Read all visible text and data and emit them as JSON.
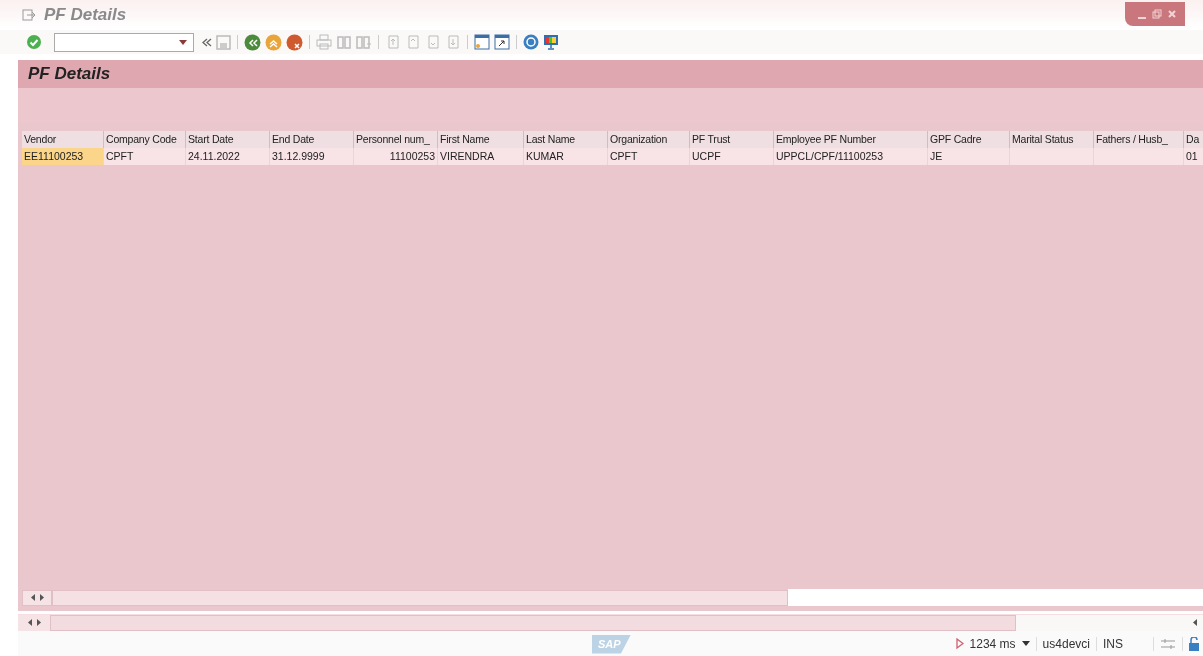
{
  "window": {
    "title": "PF Details"
  },
  "panel": {
    "title": "PF Details"
  },
  "table": {
    "columns": [
      "Vendor",
      "Company Code",
      "Start Date",
      "End Date",
      "Personnel num_",
      "First Name",
      "Last Name",
      "Organization",
      "PF Trust",
      "Employee PF Number",
      "GPF Cadre",
      "Marital Status",
      "Fathers / Husb_",
      "Da"
    ],
    "rows": [
      {
        "cells": [
          {
            "text": "EE11100253",
            "focused": true
          },
          {
            "text": "CPFT",
            "focused": false
          },
          {
            "text": "24.11.2022",
            "focused": false
          },
          {
            "text": "31.12.9999",
            "focused": false
          },
          {
            "text": "11100253",
            "focused": false
          },
          {
            "text": "VIRENDRA",
            "focused": false
          },
          {
            "text": "KUMAR",
            "focused": false
          },
          {
            "text": "CPFT",
            "focused": false
          },
          {
            "text": "UCPF",
            "focused": false
          },
          {
            "text": "UPPCL/CPF/11100253",
            "focused": false
          },
          {
            "text": "JE",
            "focused": false
          },
          {
            "text": "",
            "focused": false
          },
          {
            "text": "",
            "focused": false
          },
          {
            "text": "01",
            "focused": false
          }
        ]
      }
    ]
  },
  "footer": {
    "logo": "SAP",
    "response_time": "1234 ms",
    "server": "us4devci",
    "mode": "INS"
  }
}
